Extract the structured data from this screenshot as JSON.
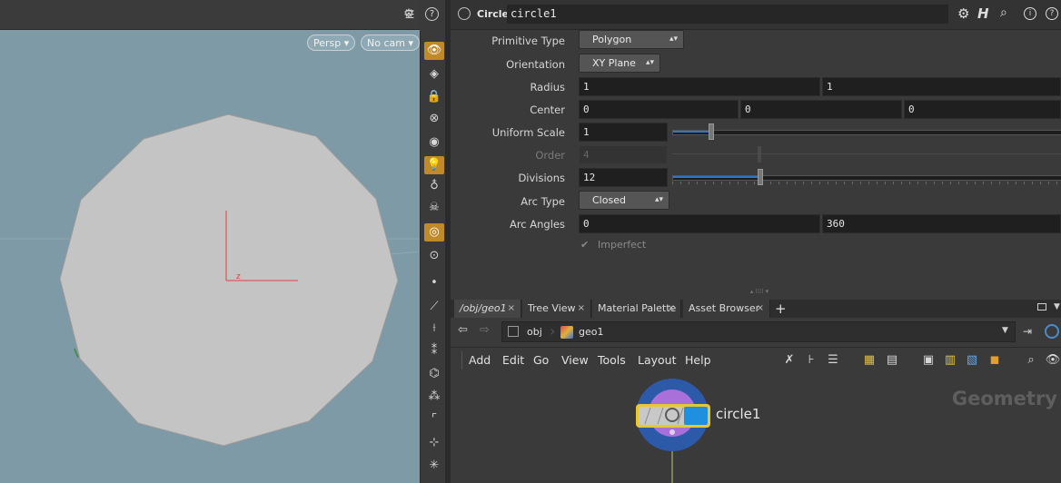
{
  "viewport": {
    "persp_label": "Persp",
    "cam_label": "No cam",
    "axis_label": "z"
  },
  "params": {
    "node_type": "Circle",
    "node_name": "circle1",
    "primitive_type": {
      "label": "Primitive Type",
      "value": "Polygon"
    },
    "orientation": {
      "label": "Orientation",
      "value": "XY Plane"
    },
    "radius": {
      "label": "Radius",
      "values": [
        "1",
        "1"
      ]
    },
    "center": {
      "label": "Center",
      "values": [
        "0",
        "0",
        "0"
      ]
    },
    "uniform_scale": {
      "label": "Uniform Scale",
      "value": "1"
    },
    "order": {
      "label": "Order",
      "value": "4"
    },
    "divisions": {
      "label": "Divisions",
      "value": "12"
    },
    "arc_type": {
      "label": "Arc Type",
      "value": "Closed"
    },
    "arc_angles": {
      "label": "Arc Angles",
      "values": [
        "0",
        "360"
      ]
    },
    "imperfect": {
      "label": "Imperfect"
    }
  },
  "tabs": [
    {
      "label": "/obj/geo1"
    },
    {
      "label": "Tree View"
    },
    {
      "label": "Material Palette"
    },
    {
      "label": "Asset Browser"
    }
  ],
  "path": {
    "obj": "obj",
    "geo": "geo1"
  },
  "network_menu": [
    "Add",
    "Edit",
    "Go",
    "View",
    "Tools",
    "Layout",
    "Help"
  ],
  "network": {
    "watermark": "Geometry",
    "node_label": "circle1"
  },
  "icons": {
    "close": "×",
    "add_tab": "+",
    "help": "?",
    "info": "i",
    "search": "⌕",
    "gear": "⚙",
    "back": "◀",
    "forward": "▶",
    "dropdown": "▾"
  },
  "colors": {
    "viewport_bg": "#7d9aa6",
    "accent_orange": "#c08a2a",
    "slider_blue": "#2f78c8",
    "node_blue": "#1f8fe0"
  }
}
